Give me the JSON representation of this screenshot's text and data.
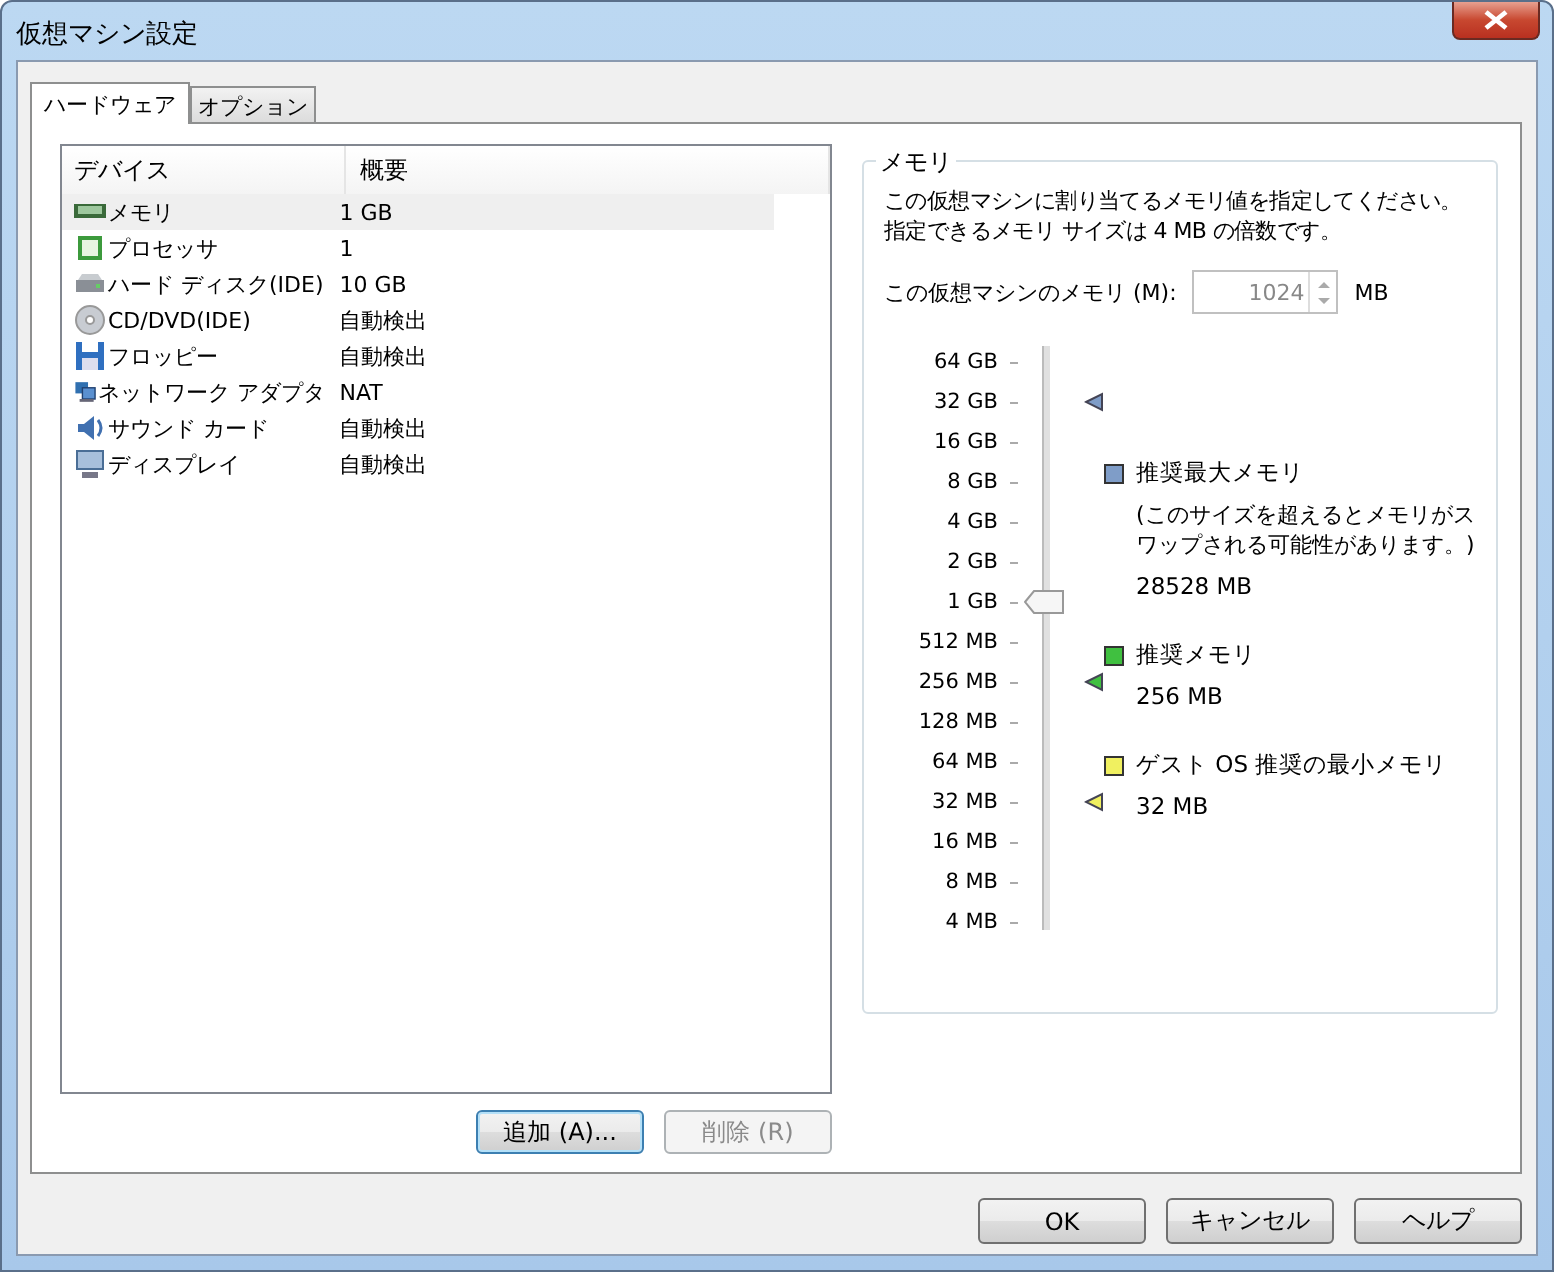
{
  "window": {
    "title": "仮想マシン設定"
  },
  "tabs": [
    {
      "label": "ハードウェア",
      "selected": true
    },
    {
      "label": "オプション",
      "selected": false
    }
  ],
  "device_table": {
    "columns": [
      "デバイス",
      "概要"
    ],
    "rows": [
      {
        "kind": "memory",
        "device": "メモリ",
        "summary": "1 GB",
        "selected": true
      },
      {
        "kind": "processor",
        "device": "プロセッサ",
        "summary": "1",
        "selected": false
      },
      {
        "kind": "disk",
        "device": "ハード ディスク(IDE)",
        "summary": "10 GB",
        "selected": false
      },
      {
        "kind": "cd",
        "device": "CD/DVD(IDE)",
        "summary": "自動検出",
        "selected": false
      },
      {
        "kind": "floppy",
        "device": "フロッピー",
        "summary": "自動検出",
        "selected": false
      },
      {
        "kind": "network",
        "device": "ネットワーク アダプタ",
        "summary": "NAT",
        "selected": false
      },
      {
        "kind": "sound",
        "device": "サウンド カード",
        "summary": "自動検出",
        "selected": false
      },
      {
        "kind": "display",
        "device": "ディスプレイ",
        "summary": "自動検出",
        "selected": false
      }
    ]
  },
  "list_buttons": [
    {
      "label": "追加 (A)...",
      "disabled": false
    },
    {
      "label": "削除 (R)",
      "disabled": true
    }
  ],
  "memory_group": {
    "title": "メモリ",
    "description": "この仮想マシンに割り当てるメモリ値を指定してください。指定できるメモリ サイズは 4 MB の倍数です。",
    "field_label": "この仮想マシンのメモリ (M):",
    "value": "1024",
    "value_disabled": true,
    "unit": "MB",
    "scale": [
      {
        "label": "64 GB",
        "selected": false
      },
      {
        "label": "32 GB",
        "selected": false,
        "color": "#7f9dc8"
      },
      {
        "label": "16 GB",
        "selected": false
      },
      {
        "label": "8 GB",
        "selected": false
      },
      {
        "label": "4 GB",
        "selected": false
      },
      {
        "label": "2 GB",
        "selected": false
      },
      {
        "label": "1 GB",
        "selected": true
      },
      {
        "label": "512 MB",
        "selected": false
      },
      {
        "label": "256 MB",
        "selected": false,
        "color": "#40c040"
      },
      {
        "label": "128 MB",
        "selected": false
      },
      {
        "label": "64 MB",
        "selected": false
      },
      {
        "label": "32 MB",
        "selected": false,
        "color": "#f0f060"
      },
      {
        "label": "16 MB",
        "selected": false
      },
      {
        "label": "8 MB",
        "selected": false
      },
      {
        "label": "4 MB",
        "selected": false
      }
    ],
    "recommendations": [
      {
        "title": "推奨最大メモリ",
        "note": "(このサイズを超えるとメモリがスワップされる可能性があります。)",
        "value": "28528 MB",
        "color": "#7f9dc8"
      },
      {
        "title": "推奨メモリ",
        "value": "256 MB",
        "color": "#40c040"
      },
      {
        "title": "ゲスト OS 推奨の最小メモリ",
        "value": "32 MB",
        "color": "#f0f060"
      }
    ]
  },
  "dialog_buttons": [
    "OK",
    "キャンセル",
    "ヘルプ"
  ]
}
